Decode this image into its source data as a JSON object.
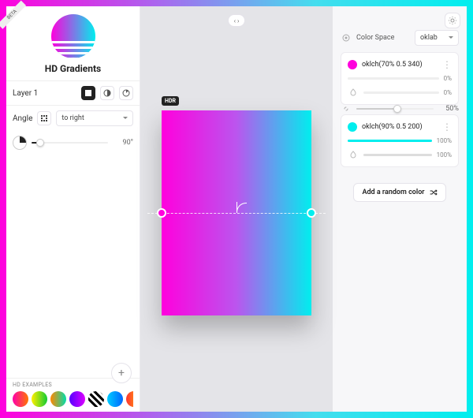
{
  "badge_beta": "BETA",
  "brand_title": "HD Gradients",
  "layer_label": "Layer 1",
  "angle_label": "Angle",
  "direction_value": "to right",
  "angle_value": "90°",
  "hdr_badge": "HDR",
  "collapse_glyph": "‹ ›",
  "colorspace_label": "Color Space",
  "colorspace_value": "oklab",
  "interp_value": "50%",
  "stops": [
    {
      "color": "#ff00dd",
      "label": "oklch(70% 0.5 340)",
      "pos": "0%",
      "opacity": "0%",
      "fill_pct": 0
    },
    {
      "color": "#00eeee",
      "label": "oklch(90% 0.5 200)",
      "pos": "100%",
      "opacity": "100%",
      "fill_pct": 100
    }
  ],
  "add_random_label": "Add a random color",
  "examples_label": "HD EXAMPLES",
  "swatches": [
    "linear-gradient(to right,#ff00aa,#ff7700)",
    "linear-gradient(to right,#ffee00,#11cc33)",
    "linear-gradient(to right,#ff8800,#00ddaa)",
    "linear-gradient(to right,#5500ff,#dd00ff)",
    "repeating-linear-gradient(45deg,#000 0 3px,#fff 3px 6px)",
    "linear-gradient(to right,#00ccff,#0066ff)",
    "linear-gradient(to right,#ff3333,#ffbb00)"
  ]
}
